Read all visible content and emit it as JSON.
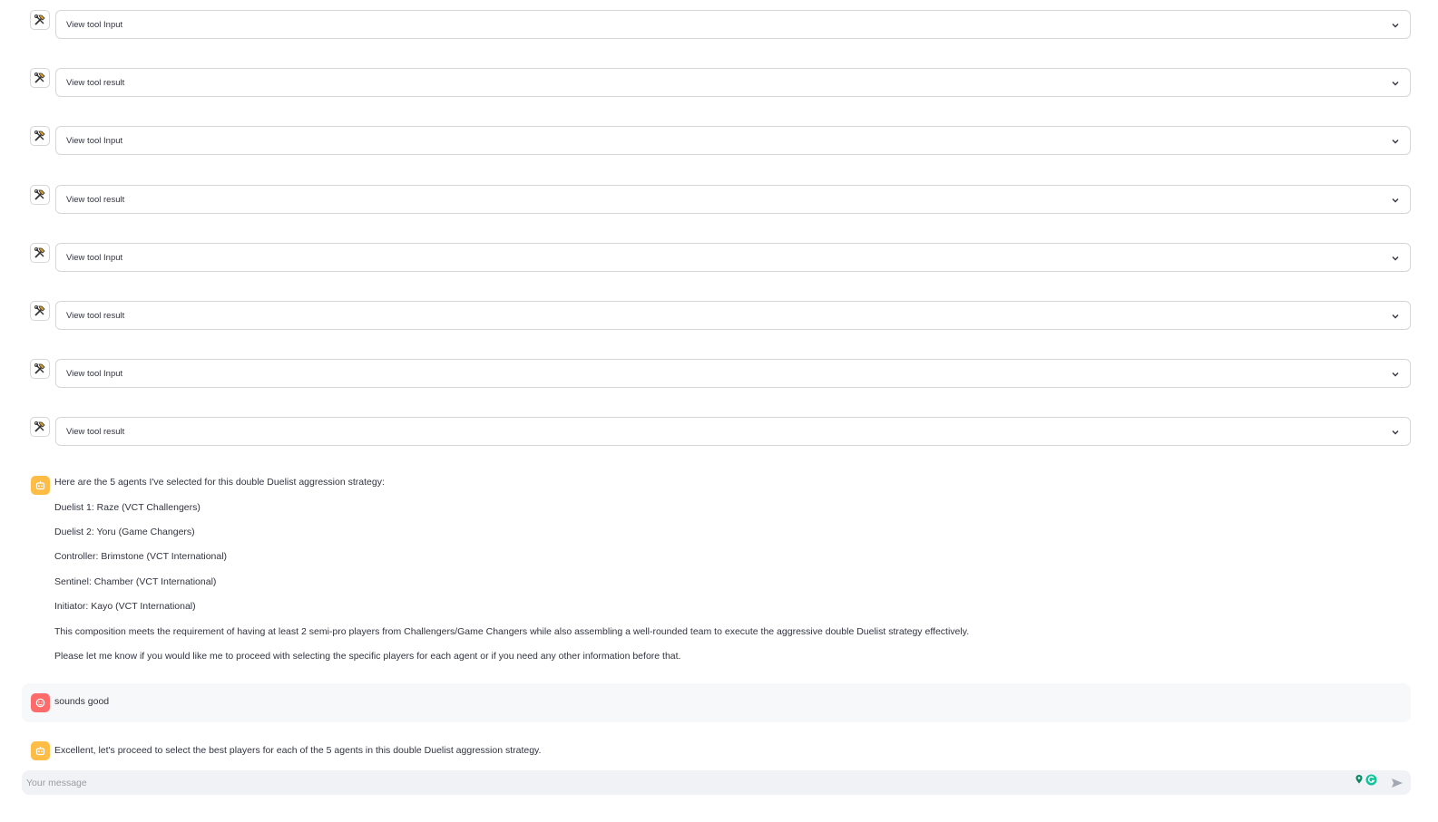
{
  "tool_calls": [
    {
      "label": "View tool Input",
      "icon": "hammer-wrench-icon"
    },
    {
      "label": "View tool result",
      "icon": "hammer-wrench-icon"
    },
    {
      "label": "View tool Input",
      "icon": "hammer-wrench-icon"
    },
    {
      "label": "View tool result",
      "icon": "hammer-wrench-icon"
    },
    {
      "label": "View tool Input",
      "icon": "hammer-wrench-icon"
    },
    {
      "label": "View tool result",
      "icon": "hammer-wrench-icon"
    },
    {
      "label": "View tool Input",
      "icon": "hammer-wrench-icon"
    },
    {
      "label": "View tool result",
      "icon": "hammer-wrench-icon"
    }
  ],
  "assistant_message_1": {
    "intro": "Here are the 5 agents I've selected for this double Duelist aggression strategy:",
    "lines": [
      "Duelist 1: Raze (VCT Challengers)",
      "Duelist 2: Yoru (Game Changers)",
      "Controller: Brimstone (VCT International)",
      "Sentinel: Chamber (VCT International)",
      "Initiator: Kayo (VCT International)",
      "This composition meets the requirement of having at least 2 semi-pro players from Challengers/Game Changers while also assembling a well-rounded team to execute the aggressive double Duelist strategy effectively.",
      "Please let me know if you would like me to proceed with selecting the specific players for each agent or if you need any other information before that."
    ]
  },
  "user_message": {
    "text": "sounds good"
  },
  "assistant_message_2": {
    "text": "Excellent, let's proceed to select the best players for each of the 5 agents in this double Duelist aggression strategy."
  },
  "chat_input": {
    "placeholder": "Your message",
    "value": ""
  },
  "colors": {
    "bot_avatar": "#ffbd45",
    "user_avatar": "#ff6b6b",
    "border": "#d6d6d9",
    "input_bg": "#f0f2f6"
  }
}
